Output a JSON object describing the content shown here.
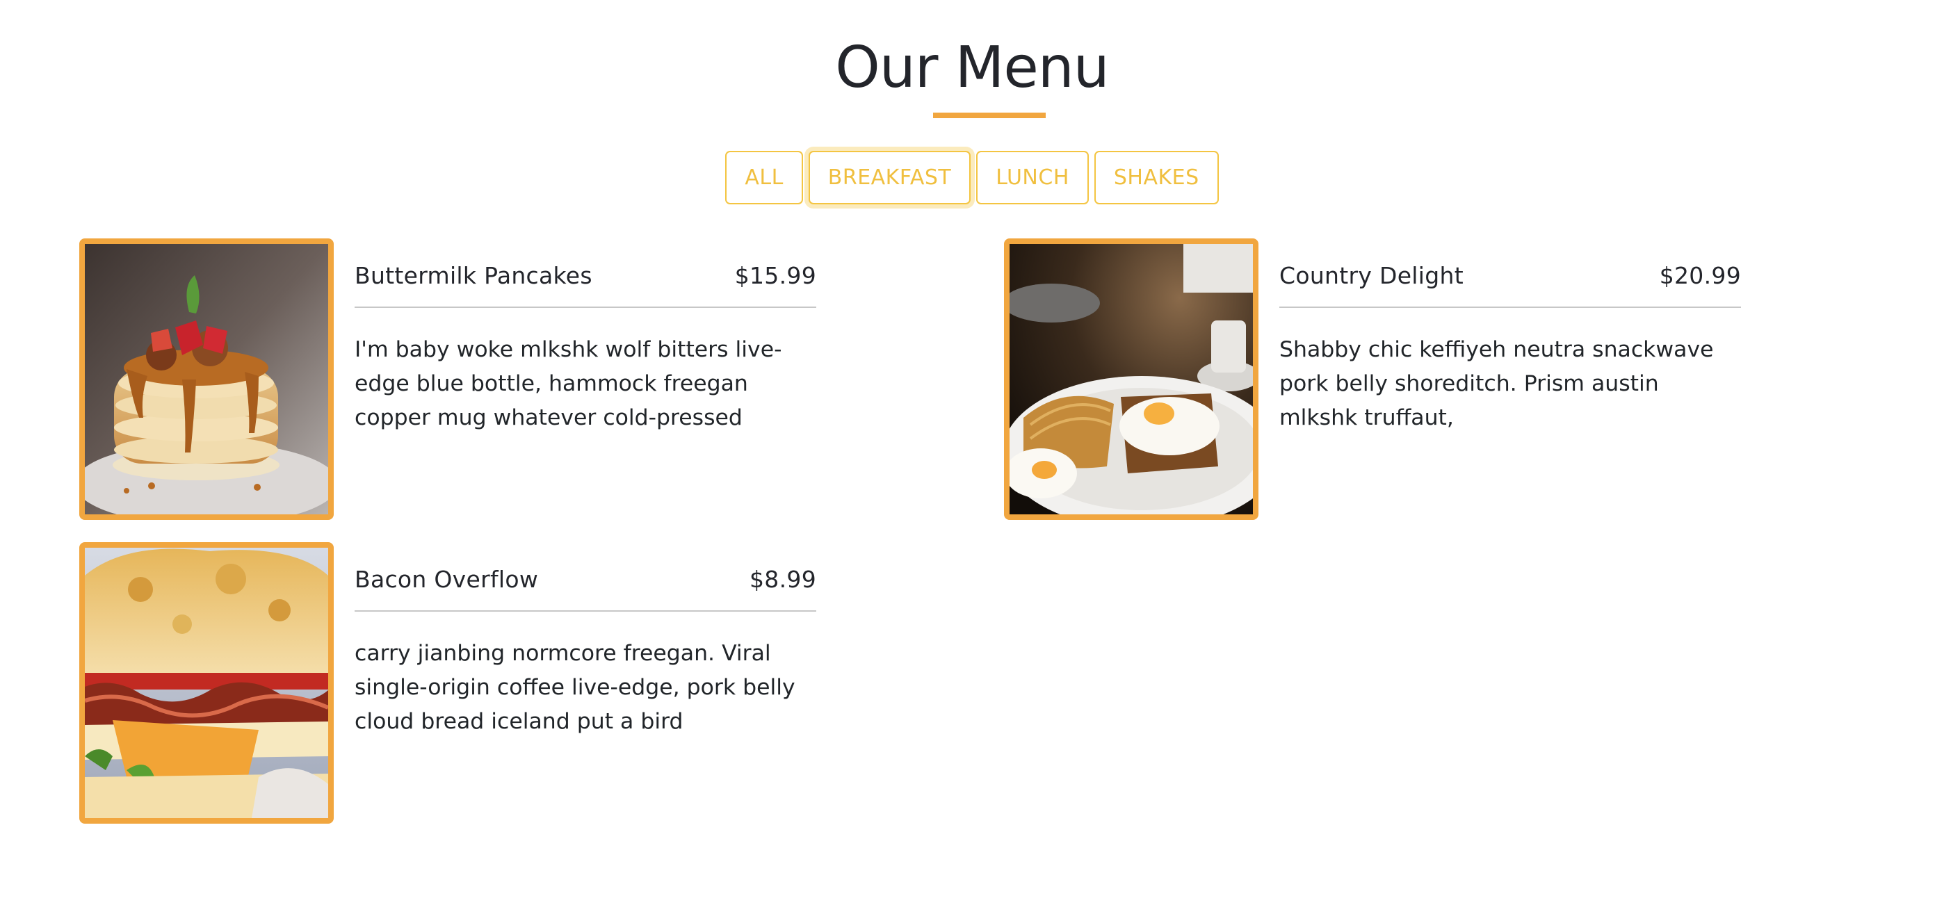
{
  "header": {
    "title": "Our Menu"
  },
  "filters": [
    {
      "label": "ALL",
      "active": false
    },
    {
      "label": "BREAKFAST",
      "active": true
    },
    {
      "label": "LUNCH",
      "active": false
    },
    {
      "label": "SHAKES",
      "active": false
    }
  ],
  "colors": {
    "accent": "#f1a63f",
    "filter_text": "#f0bf3f",
    "filter_border": "#f4c542"
  },
  "menu_items": [
    {
      "name": "Buttermilk Pancakes",
      "price": "$15.99",
      "description": "I'm baby woke mlkshk wolf bitters live-edge blue bottle, hammock freegan copper mug whatever cold-pressed",
      "image": "pancakes-photo"
    },
    {
      "name": "Country Delight",
      "price": "$20.99",
      "description": "Shabby chic keffiyeh neutra snackwave pork belly shoreditch. Prism austin mlkshk truffaut,",
      "image": "eggs-toast-photo"
    },
    {
      "name": "Bacon Overflow",
      "price": "$8.99",
      "description": "carry jianbing normcore freegan. Viral single-origin coffee live-edge, pork belly cloud bread iceland put a bird",
      "image": "bacon-biscuit-photo"
    }
  ]
}
